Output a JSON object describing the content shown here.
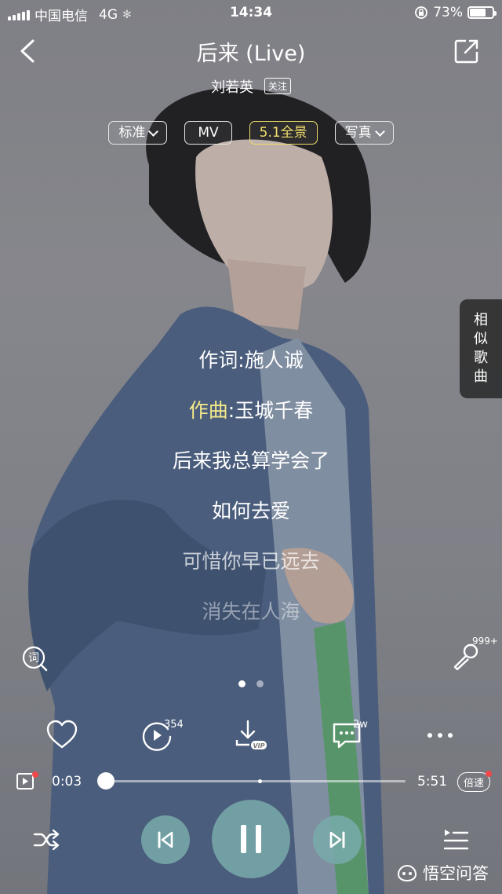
{
  "status_bar": {
    "carrier": "中国电信",
    "network": "4G",
    "time": "14:34",
    "battery": "73%",
    "battery_level": 0.73
  },
  "header": {
    "title": "后来 (Live)",
    "artist": "刘若英",
    "follow_label": "关注"
  },
  "quality_buttons": [
    {
      "label": "标准",
      "has_dropdown": true,
      "active": false
    },
    {
      "label": "MV",
      "has_dropdown": false,
      "active": false
    },
    {
      "label": "5.1全景",
      "has_dropdown": false,
      "active": true
    },
    {
      "label": "写真",
      "has_dropdown": true,
      "active": false
    }
  ],
  "similar_songs_label": [
    "相",
    "似",
    "歌",
    "曲"
  ],
  "lyrics": {
    "line1": "作词:施人诚",
    "line2_highlight": "作曲",
    "line2_rest": ":玉城千春",
    "line3": "后来我总算学会了",
    "line4": "如何去爱",
    "line5": "可惜你早已远去",
    "line6": "消失在人海"
  },
  "mic_count": "999+",
  "actions": {
    "replay_count": "354",
    "comment_count": "2w",
    "download_badge": "VIP"
  },
  "progress": {
    "current": "0:03",
    "total": "5:51",
    "fraction": 0.01,
    "speed_label": "倍速"
  },
  "watermark": "悟空问答",
  "colors": {
    "accent_yellow": "#f1df6a",
    "control_teal": "#78aaaa",
    "badge_red": "#f04848"
  },
  "icons": [
    "back-icon",
    "share-icon",
    "lyric-search-icon",
    "microphone-icon",
    "heart-icon",
    "replay-icon",
    "download-icon",
    "comment-icon",
    "more-icon",
    "video-icon",
    "shuffle-icon",
    "previous-icon",
    "pause-icon",
    "next-icon",
    "playlist-icon"
  ]
}
